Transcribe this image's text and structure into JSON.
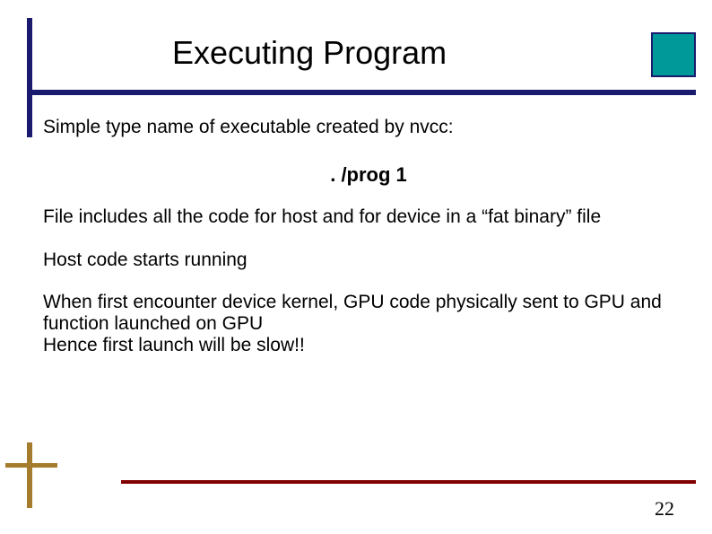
{
  "slide": {
    "title": "Executing Program",
    "para1": "Simple type name of executable created by nvcc:",
    "command": ". /prog 1",
    "para2": "File includes all the code for host and for device in a “fat binary” file",
    "para3": "Host code starts running",
    "para4": "When first encounter device kernel, GPU code physically sent to GPU and function launched on GPU\nHence first launch will be slow!!",
    "page_number": "22"
  },
  "colors": {
    "rule_primary": "#1a1a6e",
    "accent_square": "#009999",
    "ochre": "#a57c2e",
    "maroon": "#800000"
  }
}
